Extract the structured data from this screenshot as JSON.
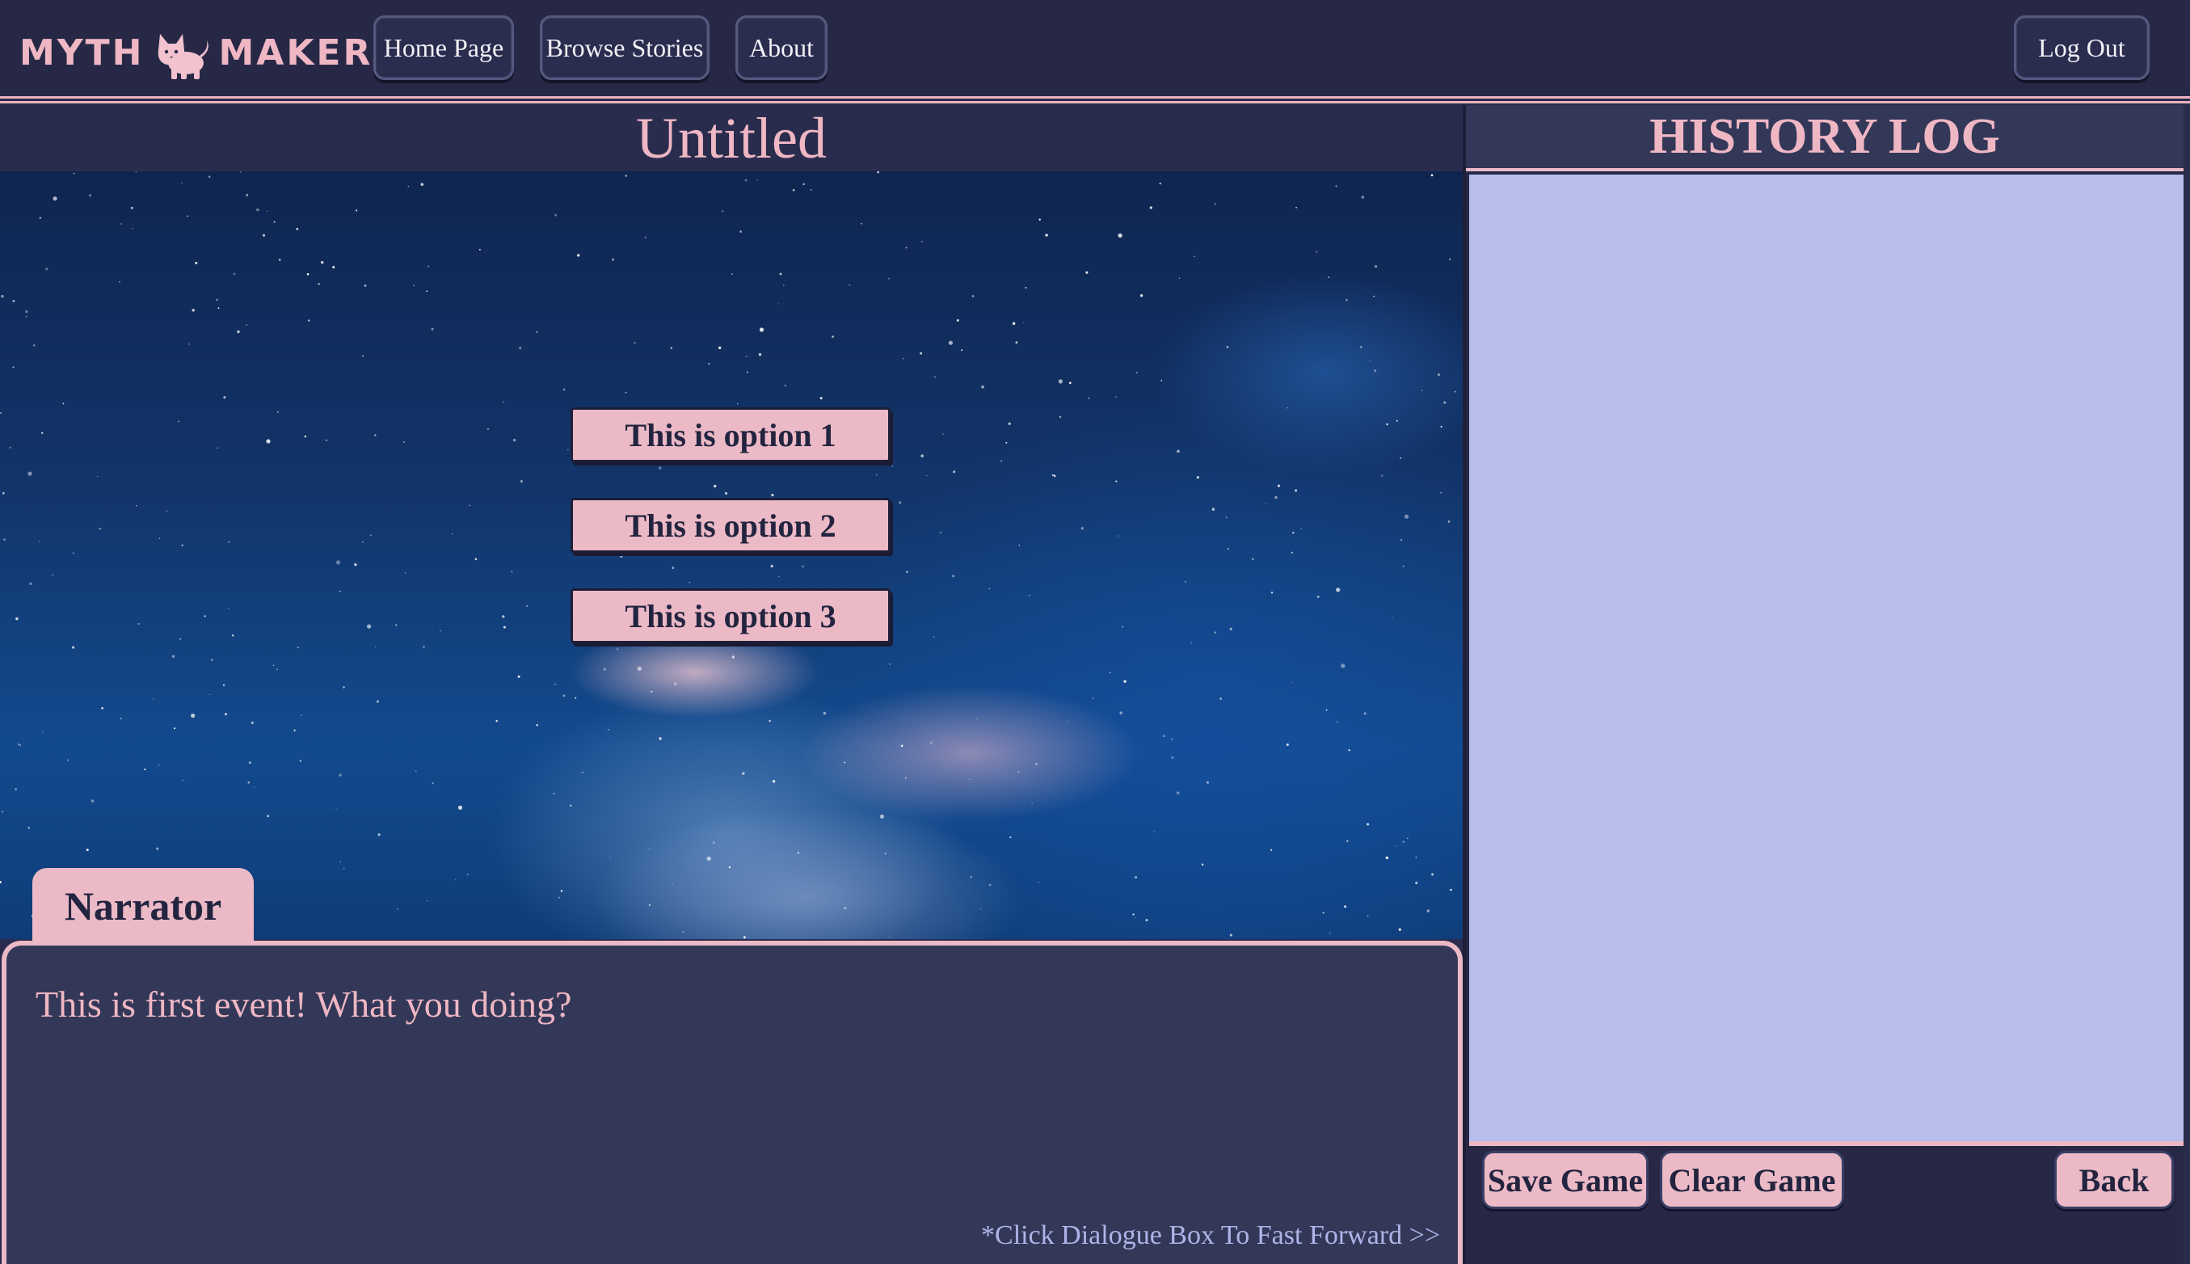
{
  "header": {
    "logo_left": "MYTH",
    "logo_right": "MAKER",
    "logo_icon": "cat-icon",
    "nav": {
      "home": "Home Page",
      "browse": "Browse Stories",
      "about": "About",
      "logout": "Log Out"
    }
  },
  "story": {
    "title": "Untitled",
    "options": [
      "This is option 1",
      "This is option 2",
      "This is option 3"
    ],
    "speaker": "Narrator",
    "dialogue": "This is first event! What you doing?",
    "fast_forward_hint": "*Click Dialogue Box To Fast Forward >>"
  },
  "history": {
    "title": "HISTORY LOG",
    "entries": [],
    "buttons": {
      "save": "Save Game",
      "clear": "Clear Game",
      "back": "Back"
    }
  },
  "colors": {
    "accent_pink": "#ebbac6",
    "nav_bg": "#262846",
    "panel_bg": "#343858",
    "history_bg": "#b7beec",
    "hint_text": "#aeb4e8"
  }
}
